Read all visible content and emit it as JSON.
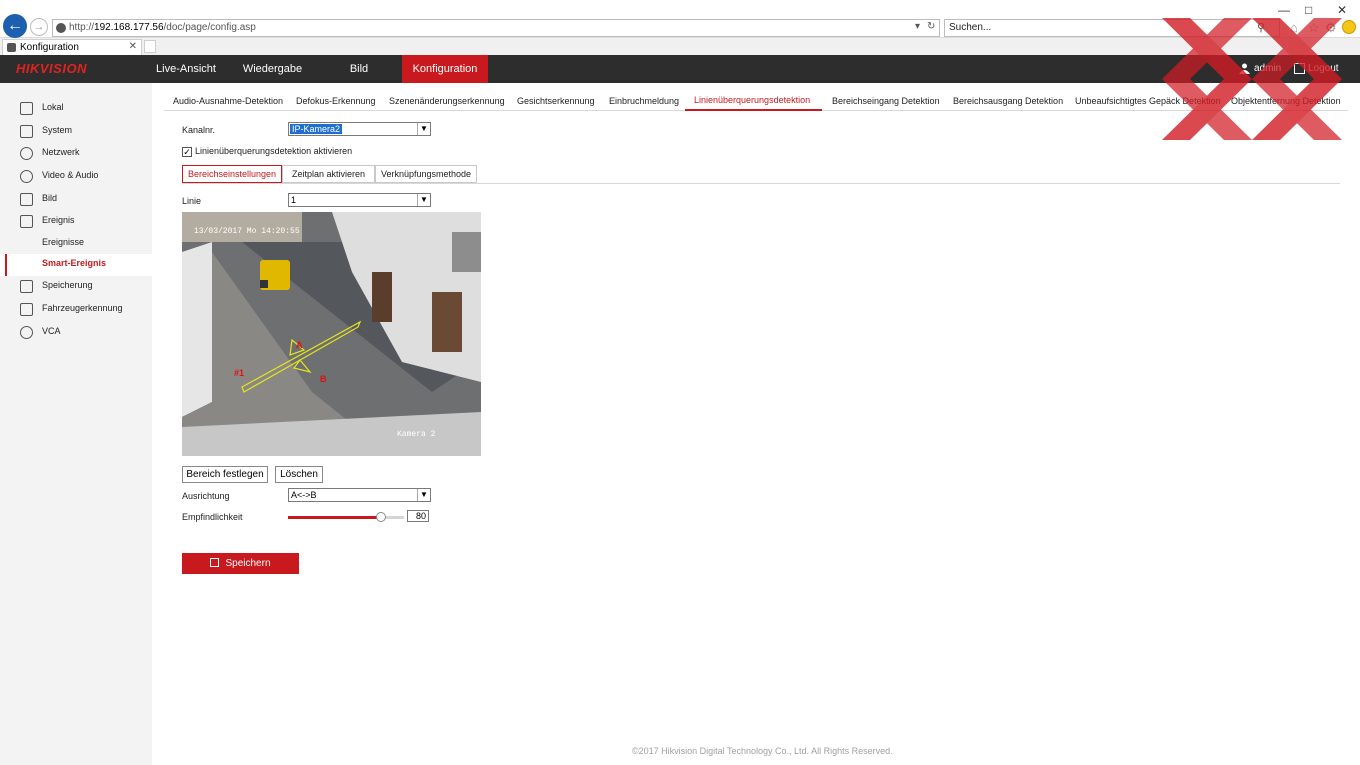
{
  "browser": {
    "url_prefix": "http://",
    "url_host": "192.168.177.56",
    "url_path": "/doc/page/config.asp",
    "search_placeholder": "Suchen...",
    "tab_title": "Konfiguration"
  },
  "header": {
    "logo": "HIKVISION",
    "nav": [
      "Live-Ansicht",
      "Wiedergabe",
      "Bild",
      "Konfiguration"
    ],
    "user": "admin",
    "logout": "Logout"
  },
  "sidebar": {
    "items": [
      {
        "label": "Lokal",
        "icon": "monitor-icon"
      },
      {
        "label": "System",
        "icon": "system-icon"
      },
      {
        "label": "Netzwerk",
        "icon": "globe-icon"
      },
      {
        "label": "Video & Audio",
        "icon": "video-audio-icon"
      },
      {
        "label": "Bild",
        "icon": "image-icon"
      },
      {
        "label": "Ereignis",
        "icon": "calendar-icon"
      },
      {
        "label": "Ereignisse",
        "icon": ""
      },
      {
        "label": "Smart-Ereignis",
        "icon": ""
      },
      {
        "label": "Speicherung",
        "icon": "storage-icon"
      },
      {
        "label": "Fahrzeugerkennung",
        "icon": "vehicle-search-icon"
      },
      {
        "label": "VCA",
        "icon": "vca-icon"
      }
    ]
  },
  "subtabs": [
    "Audio-Ausnahme-Detektion",
    "Defokus-Erkennung",
    "Szenenänderungserkennung",
    "Gesichtserkennung",
    "Einbruchmeldung",
    "Linienüberquerungsdetektion",
    "Bereichseingang Detektion",
    "Bereichsausgang Detektion",
    "Unbeaufsichtigtes Gepäck Detektion",
    "Objektentfernung Detektion"
  ],
  "form": {
    "channel_label": "Kanalnr.",
    "channel_value": "IP-Kamera2",
    "enable_label": "Linienüberquerungsdetektion aktivieren",
    "enable_checked": true,
    "steps": [
      "Bereichseinstellungen",
      "Zeitplan aktivieren",
      "Verknüpfungsmethode"
    ],
    "line_label": "Linie",
    "line_value": "1",
    "video_timestamp": "13/03/2017 Mo 14:20:55",
    "video_camera": "Kamera 2",
    "video_label_a": "A",
    "video_label_b": "B",
    "video_line_id": "#1",
    "set_area_button": "Bereich festlegen",
    "delete_button": "Löschen",
    "direction_label": "Ausrichtung",
    "direction_value": "A<->B",
    "sensitivity_label": "Empfindlichkeit",
    "sensitivity_value": 80,
    "save_button": "Speichern"
  },
  "footer": "©2017 Hikvision Digital Technology Co., Ltd. All Rights Reserved.",
  "colors": {
    "accent": "#c8191f",
    "header_bg": "#2d2d2d",
    "sidebar_bg": "#f3f3f3"
  }
}
